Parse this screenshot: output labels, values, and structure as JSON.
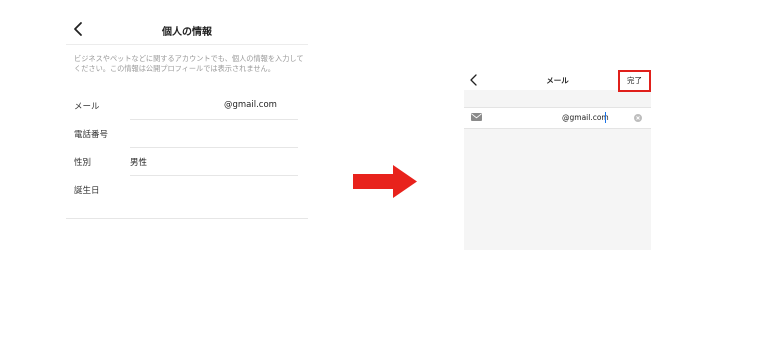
{
  "left_screen": {
    "title": "個人の情報",
    "description": "ビジネスやペットなどに関するアカウントでも、個人の情報を入力してください。この情報は公開プロフィールでは表示されません。",
    "rows": [
      {
        "label": "メール",
        "value": "@gmail.com"
      },
      {
        "label": "電話番号",
        "value": ""
      },
      {
        "label": "性別",
        "value": "男性"
      },
      {
        "label": "誕生日",
        "value": ""
      }
    ],
    "icons": {
      "back": "chevron-left-icon"
    }
  },
  "arrow": {
    "color": "#e8221c",
    "icon": "right-arrow-icon"
  },
  "right_screen": {
    "title": "メール",
    "done_label": "完了",
    "email_value": "@gmail.com",
    "highlight_color": "#e0201b",
    "icons": {
      "back": "chevron-left-icon",
      "mail": "envelope-icon",
      "clear": "clear-circle-icon"
    }
  }
}
